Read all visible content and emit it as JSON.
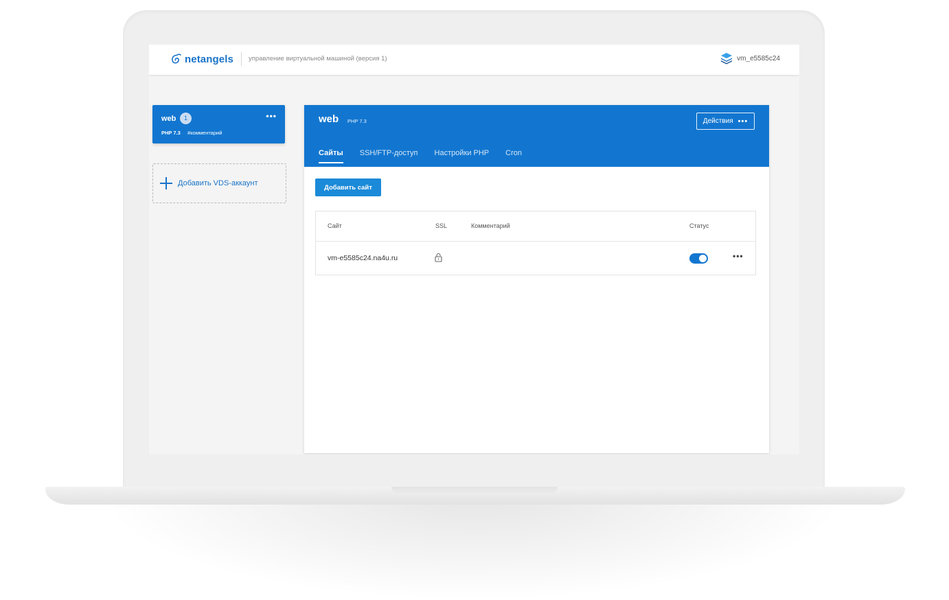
{
  "header": {
    "logo_text": "netangels",
    "subtitle": "управление виртуальной машиной (версия 1)",
    "vm_name": "vm_e5585c24"
  },
  "sidebar": {
    "account": {
      "name": "web",
      "badge": "1",
      "more": "•••",
      "php": "PHP 7.3",
      "comment": "#комментарий"
    },
    "add_account_label": "Добавить VDS-аккаунт"
  },
  "panel": {
    "title": "web",
    "php": "PHP 7.3",
    "actions_label": "Действия",
    "actions_dots": "•••",
    "tabs": [
      {
        "label": "Сайты",
        "active": true
      },
      {
        "label": "SSH/FTP-доступ",
        "active": false
      },
      {
        "label": "Настройки PHP",
        "active": false
      },
      {
        "label": "Cron",
        "active": false
      }
    ],
    "add_site_label": "Добавить сайт",
    "table": {
      "columns": [
        "Сайт",
        "SSL",
        "Комментарий",
        "Статус"
      ],
      "rows": [
        {
          "site": "vm-e5585c24.na4u.ru",
          "ssl_icon": "lock-icon",
          "comment": "",
          "status_enabled": true,
          "more": "•••"
        }
      ]
    }
  },
  "colors": {
    "accent": "#1276d0",
    "button": "#1b8ad8",
    "logo": "#1a73c8"
  }
}
